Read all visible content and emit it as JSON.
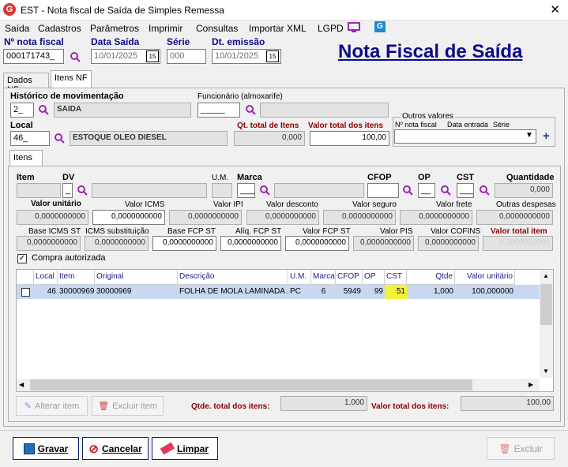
{
  "window": {
    "title": "EST - Nota fiscal de Saída de Simples Remessa",
    "app_icon": "G",
    "close": "✕"
  },
  "menu": [
    "Saída",
    "Cadastros",
    "Parâmetros",
    "Imprimir",
    "Consultas",
    "Importar XML",
    "LGPD"
  ],
  "header": {
    "nota_label": "Nº nota fiscal",
    "nota_value": "000171743_",
    "data_saida_label": "Data Saída",
    "data_saida_value": "10/01/2025",
    "serie_label": "Série",
    "serie_value": "000",
    "dt_emissao_label": "Dt. emissão",
    "dt_emissao_value": "10/01/2025",
    "cal_text": "15",
    "page_title": "Nota Fiscal de Saída"
  },
  "tabs": {
    "dados": "Dados NF",
    "itens": "Itens NF",
    "itens_inner": "Itens"
  },
  "itensnf": {
    "hist_label": "Histórico de movimentação",
    "hist_code": "2_",
    "hist_desc": "SAIDA",
    "func_label": "Funcionário (almoxarife)",
    "func_code": "_____",
    "func_desc": "",
    "local_label": "Local",
    "local_code": "46_",
    "local_desc": "ESTOQUE OLEO DIESEL",
    "qt_total_label": "Qt. total de Itens",
    "qt_total_value": "0,000",
    "valor_total_label": "Valor total dos itens",
    "valor_total_value": "100,00",
    "outros_label": "Outros valores",
    "outros_col1": "Nº nota fiscal",
    "outros_col2": "Data entrada",
    "outros_col3": "Série",
    "plus": "+"
  },
  "item_form": {
    "item_label": "Item",
    "dv_label": "DV",
    "dv_value": "_",
    "um_label": "U.M.",
    "marca_label": "Marca",
    "marca_value": "___",
    "cfop_label": "CFOP",
    "op_label": "OP",
    "op_value": "__",
    "cst_label": "CST",
    "cst_value": "___",
    "quantidade_label": "Quantidade",
    "quantidade_value": "0,000",
    "row1": [
      {
        "label": "Valor unitário",
        "value": "0,0000000000"
      },
      {
        "label": "Valor ICMS",
        "value": "0,0000000000"
      },
      {
        "label": "Valor IPI",
        "value": "0,0000000000"
      },
      {
        "label": "Valor desconto",
        "value": "0,0000000000"
      },
      {
        "label": "Valor seguro",
        "value": "0,0000000000"
      },
      {
        "label": "Valor frete",
        "value": "0,0000000000"
      },
      {
        "label": "Outras despesas",
        "value": "0,0000000000"
      }
    ],
    "row2": [
      {
        "label": "Base ICMS ST",
        "value": "0,0000000000"
      },
      {
        "label": "ICMS substituição",
        "value": "0,0000000000"
      },
      {
        "label": "Base FCP ST",
        "value": "0,0000000000"
      },
      {
        "label": "Alíq. FCP ST",
        "value": "0,0000000000"
      },
      {
        "label": "Valor FCP ST",
        "value": "0,0000000000"
      },
      {
        "label": "Valor PIS",
        "value": "0,0000000000"
      },
      {
        "label": "Valor COFINS",
        "value": "0,0000000000"
      },
      {
        "label": "Valor total item",
        "value": "0,0000000000"
      }
    ],
    "compra_label": "Compra autorizada",
    "check": "✓"
  },
  "grid": {
    "headers": [
      "Local",
      "Item",
      "Original",
      "Descrição",
      "U.M.",
      "Marca",
      "CFOP",
      "OP",
      "CST",
      "Qtde",
      "Valor unitário"
    ],
    "rows": [
      [
        "46",
        "30000969",
        "30000969",
        "FOLHA DE MOLA LAMINADA ...",
        "PC",
        "6",
        "5949",
        "99",
        "51",
        "1,000",
        "100,000000"
      ]
    ]
  },
  "footer": {
    "alterar": "Alterar item",
    "excluir_item": "Excluir item",
    "qtde_total_label": "Qtde. total dos itens:",
    "qtde_total_value": "1,000",
    "valor_total_label": "Valor total dos itens:",
    "valor_total_value": "100,00"
  },
  "buttons": {
    "gravar": "Gravar",
    "cancelar": "Cancelar",
    "limpar": "Limpar",
    "excluir": "Excluir"
  },
  "colors": {
    "title_blue": "#0b0b8c",
    "label_red": "#8b0000",
    "row_highlight": "#c8d8f0",
    "cst_yellow": "#f2f23a"
  }
}
